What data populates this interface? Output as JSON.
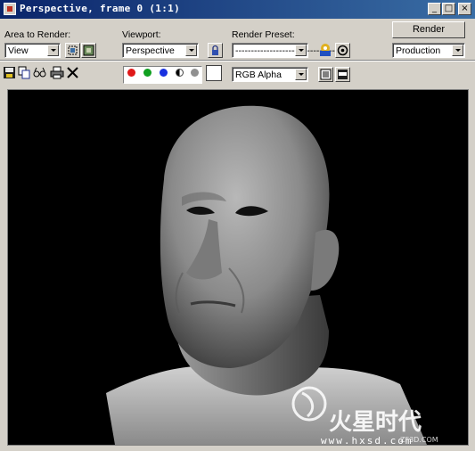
{
  "window": {
    "title": "Perspective, frame 0 (1:1)",
    "controls": {
      "minimize": "_",
      "maximize": "□",
      "close": "×"
    }
  },
  "toolbar": {
    "area_label": "Area to Render:",
    "area_value": "View",
    "viewport_label": "Viewport:",
    "viewport_value": "Perspective",
    "preset_label": "Render Preset:",
    "preset_value": "--------------------------------",
    "render_button": "Render",
    "production_value": "Production",
    "channel_value": "RGB Alpha"
  },
  "channels": [
    {
      "name": "red-channel",
      "color": "#e01818"
    },
    {
      "name": "green-channel",
      "color": "#10a020"
    },
    {
      "name": "blue-channel",
      "color": "#1830e0"
    },
    {
      "name": "alpha-channel",
      "color": "#404040"
    },
    {
      "name": "mono-channel",
      "color": "#909090"
    }
  ],
  "watermark": {
    "brand": "火星时代",
    "url": "www.hxsd.com",
    "subtitle": "ZF3D.COM"
  },
  "icons": {
    "save": "floppy-icon",
    "copy": "copy-icon",
    "clone": "clone-icon",
    "print": "printer-icon",
    "clear": "close-x-icon"
  }
}
